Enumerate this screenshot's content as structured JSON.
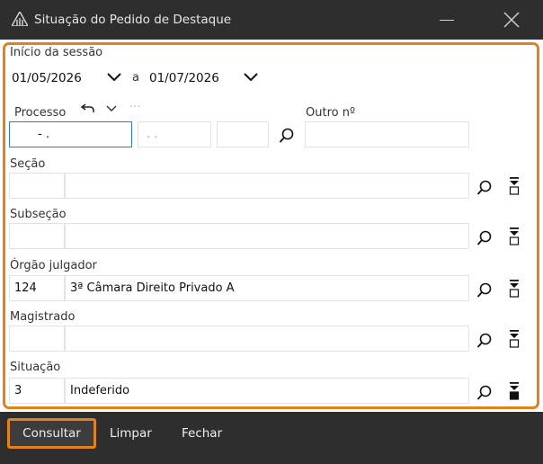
{
  "window": {
    "title": "Situação do Pedido de Destaque",
    "icon": "building-icon"
  },
  "session": {
    "label": "Início da sessão",
    "start_date": "01/05/2026",
    "separator": "a",
    "end_date": "01/07/2026"
  },
  "processo": {
    "label": "Processo",
    "field1": "- .",
    "field2": ". .",
    "field3": "",
    "more": "···",
    "outro_label": "Outro nº",
    "outro_value": ""
  },
  "secao": {
    "label": "Seção",
    "code": "",
    "name": ""
  },
  "subsecao": {
    "label": "Subseção",
    "code": "",
    "name": ""
  },
  "orgao": {
    "label": "Órgão julgador",
    "code": "124",
    "name": "3ª Câmara Direito Privado A"
  },
  "magistrado": {
    "label": "Magistrado",
    "code": "",
    "name": ""
  },
  "situacao": {
    "label": "Situação",
    "code": "3",
    "name": "Indeferido"
  },
  "footer": {
    "consultar": "Consultar",
    "limpar": "Limpar",
    "fechar": "Fechar"
  },
  "colors": {
    "accent": "#e0821f",
    "focus": "#2b7ad6",
    "chrome": "#2e2e2e"
  }
}
